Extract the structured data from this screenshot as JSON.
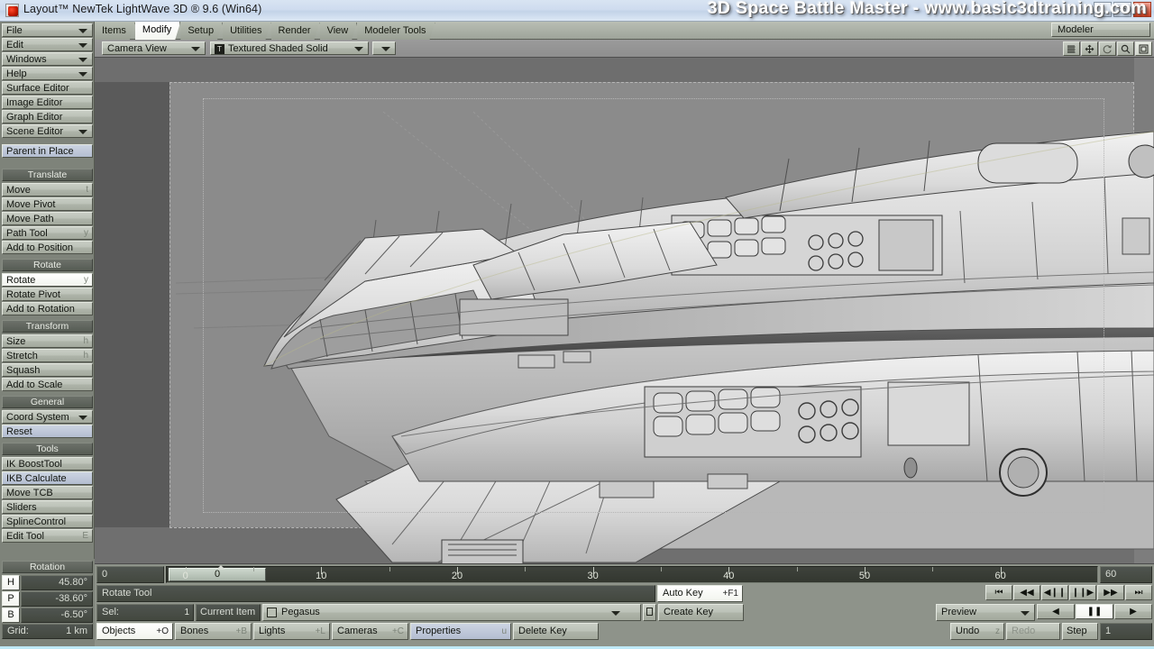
{
  "window": {
    "title": "Layout™ NewTek LightWave 3D ® 9.6  (Win64)",
    "icon": "lightwave-icon",
    "controls": {
      "minimize": "_",
      "maximize": "▭",
      "close": "✕"
    },
    "overlay_title": "3D Space Battle Master - www.basic3dtraining.com"
  },
  "menu_tabs": [
    {
      "label": "Items",
      "active": false
    },
    {
      "label": "Modify",
      "active": true
    },
    {
      "label": "Setup",
      "active": false
    },
    {
      "label": "Utilities",
      "active": false
    },
    {
      "label": "Render",
      "active": false
    },
    {
      "label": "View",
      "active": false
    },
    {
      "label": "Modeler Tools",
      "active": false
    }
  ],
  "modeler_button": "Modeler",
  "toolbar2": {
    "view_mode": "Camera View",
    "shading_mode": "Textured Shaded Solid",
    "shading_icon": "T",
    "viewport_icons": [
      "grid-icon",
      "move-icon",
      "rotate-icon",
      "zoom-icon",
      "maximize-icon"
    ]
  },
  "sidebar": {
    "menus": [
      {
        "label": "File",
        "type": "dropdown"
      },
      {
        "label": "Edit",
        "type": "dropdown"
      },
      {
        "label": "Windows",
        "type": "dropdown"
      },
      {
        "label": "Help",
        "type": "dropdown"
      }
    ],
    "editors": [
      {
        "label": "Surface Editor",
        "key": ""
      },
      {
        "label": "Image Editor",
        "key": ""
      },
      {
        "label": "Graph Editor",
        "key": ""
      },
      {
        "label": "Scene Editor",
        "type": "dropdown"
      }
    ],
    "parent_in_place": "Parent in Place",
    "groups": [
      {
        "title": "Translate",
        "items": [
          {
            "label": "Move",
            "key": "t"
          },
          {
            "label": "Move Pivot",
            "key": ""
          },
          {
            "label": "Move Path",
            "key": ""
          },
          {
            "label": "Path Tool",
            "key": "y"
          },
          {
            "label": "Add to Position",
            "key": ""
          }
        ]
      },
      {
        "title": "Rotate",
        "items": [
          {
            "label": "Rotate",
            "key": "y",
            "active": true
          },
          {
            "label": "Rotate Pivot",
            "key": ""
          },
          {
            "label": "Add to Rotation",
            "key": ""
          }
        ]
      },
      {
        "title": "Transform",
        "items": [
          {
            "label": "Size",
            "key": "h"
          },
          {
            "label": "Stretch",
            "key": "h"
          },
          {
            "label": "Squash",
            "key": ""
          },
          {
            "label": "Add to Scale",
            "key": ""
          }
        ]
      },
      {
        "title": "General",
        "items": [
          {
            "label": "Coord System",
            "type": "dropdown"
          },
          {
            "label": "Reset",
            "key": "",
            "blue": true
          }
        ]
      },
      {
        "title": "Tools",
        "items": [
          {
            "label": "IK BoostTool",
            "key": ""
          },
          {
            "label": "IKB Calculate",
            "key": "",
            "blue": true
          },
          {
            "label": "Move TCB",
            "key": ""
          },
          {
            "label": "Sliders",
            "key": ""
          },
          {
            "label": "SplineControl",
            "key": ""
          },
          {
            "label": "Edit Tool",
            "key": "E"
          }
        ]
      }
    ]
  },
  "rotation_panel": {
    "title": "Rotation",
    "channels": [
      {
        "label": "H",
        "value": "45.80°"
      },
      {
        "label": "P",
        "value": "-38.60°"
      },
      {
        "label": "B",
        "value": "-6.50°"
      }
    ],
    "grid_label": "Grid:",
    "grid_value": "1 km"
  },
  "timeline": {
    "current_frame": "0",
    "scrubber_frame": "0",
    "end_frame": "60",
    "ticks": [
      0,
      10,
      20,
      30,
      40,
      50,
      60
    ],
    "range_start": 0,
    "range_end": 60,
    "tool_name": "Rotate Tool",
    "sel_label": "Sel:",
    "sel_count": "1",
    "current_item_label": "Current Item",
    "current_item_value": "Pegasus",
    "object_buttons": [
      {
        "label": "Objects",
        "key": "+O",
        "active": true
      },
      {
        "label": "Bones",
        "key": "+B"
      },
      {
        "label": "Lights",
        "key": "+L"
      },
      {
        "label": "Cameras",
        "key": "+C"
      },
      {
        "label": "Properties",
        "key": "u",
        "blue": true
      }
    ],
    "key_buttons": [
      {
        "label": "Auto Key",
        "key": "+F1",
        "active": true
      },
      {
        "label": "Create Key",
        "key": ""
      },
      {
        "label": "Delete Key",
        "key": ""
      }
    ],
    "transport": [
      "⏮",
      "◀◀",
      "◀❙❙",
      "❙❙▶",
      "▶▶",
      "⏭"
    ],
    "preview_label": "Preview",
    "undo_label": "Undo",
    "undo_key": "z",
    "redo_label": "Redo",
    "play_buttons": [
      "◀",
      "❚❚",
      "▶"
    ],
    "step_label": "Step",
    "step_value": "1"
  },
  "colors": {
    "accent": "#bfe9f7",
    "widget_face": "#bcc2b8",
    "panel_bg": "#7e837a",
    "viewport_bg": "#8b8b8b",
    "dark_field": "#43483f",
    "title_gradient": "#cfdcef"
  }
}
